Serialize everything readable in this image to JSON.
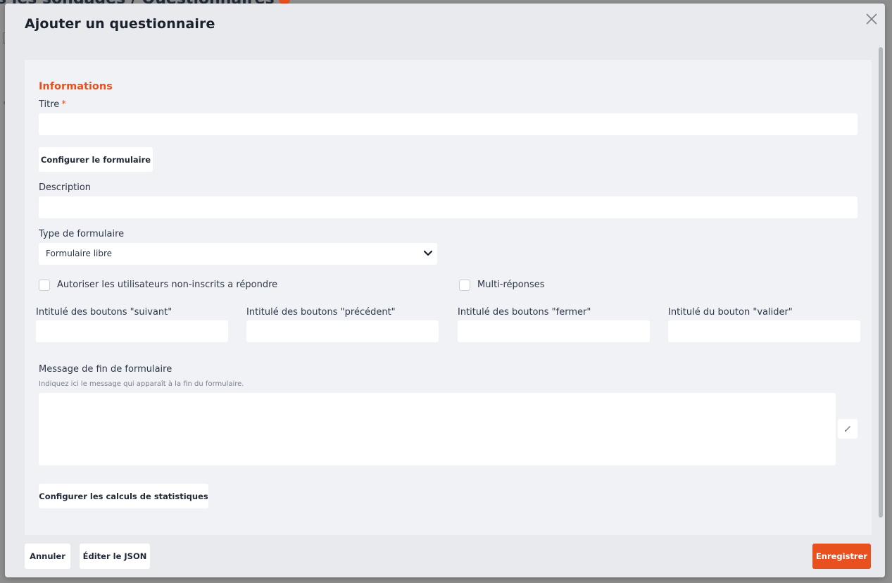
{
  "background": {
    "page_title": "s les sondages / Questionnaires"
  },
  "modal": {
    "title": "Ajouter un questionnaire",
    "close_icon": "close-icon"
  },
  "form": {
    "section_title": "Informations",
    "title_label": "Titre",
    "required_mark": "*",
    "title_value": "",
    "configure_form_button": "Configurer le formulaire",
    "description_label": "Description",
    "description_value": "",
    "form_type_label": "Type de formulaire",
    "form_type_selected": "Formulaire libre",
    "allow_anonymous_label": "Autoriser les utilisateurs non-inscrits a répondre",
    "allow_anonymous_checked": false,
    "multi_responses_label": "Multi-réponses",
    "multi_responses_checked": false,
    "next_buttons_label": "Intitulé des boutons \"suivant\"",
    "prev_buttons_label": "Intitulé des boutons \"précédent\"",
    "close_buttons_label": "Intitulé des boutons \"fermer\"",
    "validate_button_label": "Intitulé du bouton \"valider\"",
    "end_message_label": "Message de fin de formulaire",
    "end_message_hint": "Indiquez ici le message qui apparaît à la fin du formulaire.",
    "configure_stats_button": "Configurer les calculs de statistiques"
  },
  "footer": {
    "cancel_button": "Annuler",
    "edit_json_button": "Éditer le JSON",
    "save_button": "Enregistrer"
  },
  "colors": {
    "accent": "#e8501f",
    "modal_background": "#e8eaee",
    "panel_background": "#f1f2f6"
  }
}
